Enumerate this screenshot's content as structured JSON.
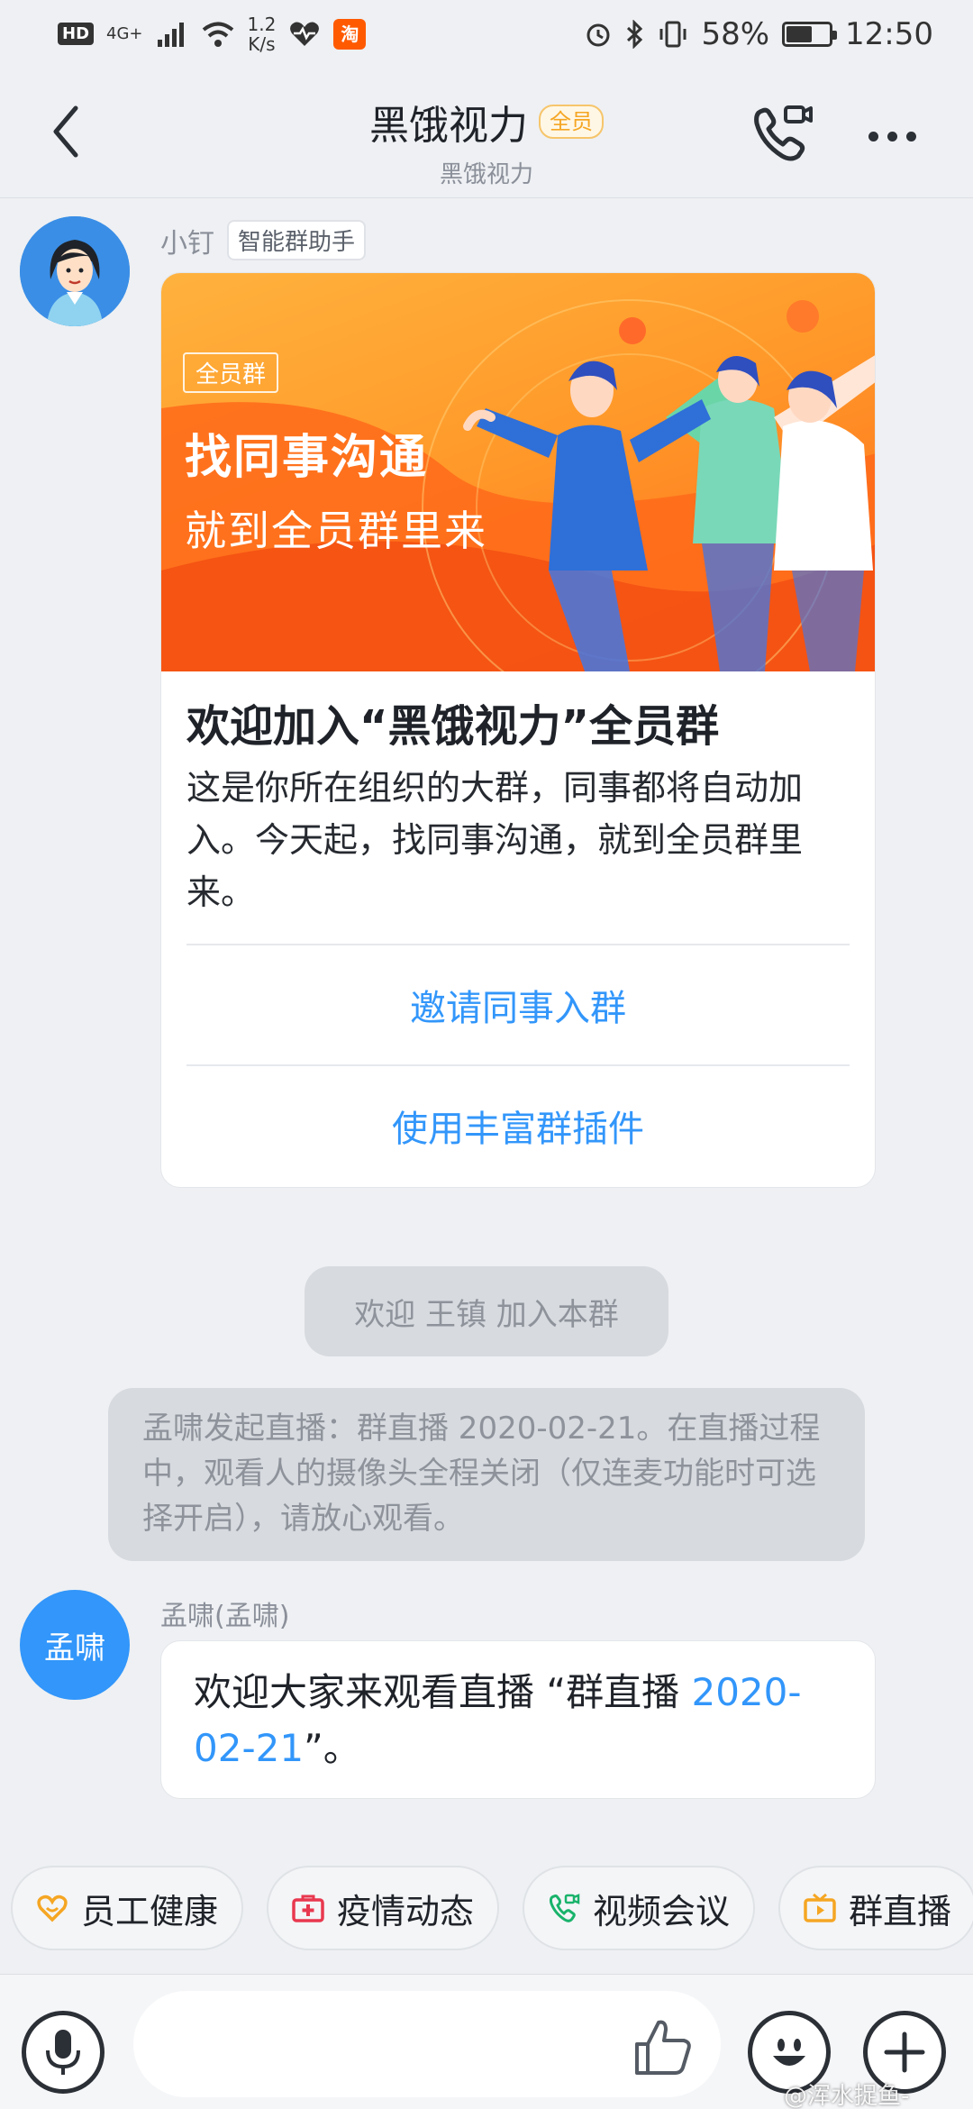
{
  "status_bar": {
    "hd": "HD",
    "network": "4G+",
    "speed_value": "1.2",
    "speed_unit": "K/s",
    "taobao_icon": "淘",
    "battery": "58%",
    "battery_level": 0.58,
    "time": "12:50",
    "icons": [
      "hd-badge",
      "signal-icon",
      "wifi-icon",
      "health-heart-icon",
      "taobao-icon",
      "alarm-icon",
      "bluetooth-icon",
      "vibrate-icon",
      "battery-icon"
    ]
  },
  "header": {
    "title": "黑饿视力",
    "badge": "全员",
    "subtitle": "黑饿视力",
    "icons": [
      "back-icon",
      "video-call-icon",
      "more-icon"
    ]
  },
  "messages": {
    "bot": {
      "sender": "小钉",
      "sender_tag": "智能群助手",
      "card": {
        "banner_tag": "全员群",
        "banner_title": "找同事沟通",
        "banner_subtitle": "就到全员群里来",
        "title": "欢迎加入“黑饿视力”全员群",
        "description": "这是你所在组织的大群，同事都将自动加入。今天起，找同事沟通，就到全员群里来。",
        "action_invite": "邀请同事入群",
        "action_plugins": "使用丰富群插件"
      }
    },
    "system_welcome": "欢迎 王镇 加入本群",
    "system_live_notice": "孟啸发起直播：群直播 2020-02-21。在直播过程中，观看人的摄像头全程关闭（仅连麦功能时可选择开启），请放心观看。",
    "user": {
      "avatar_text": "孟啸",
      "sender": "孟啸(孟啸)",
      "text_before": "欢迎大家来观看直播 “群直播 ",
      "link": "2020-02-21",
      "text_after": "”。"
    }
  },
  "quick_actions": [
    {
      "label": "员工健康",
      "icon": "heart-icon",
      "color": "#f5a623"
    },
    {
      "label": "疫情动态",
      "icon": "medical-kit-icon",
      "color": "#e8384f"
    },
    {
      "label": "视频会议",
      "icon": "video-call-icon",
      "color": "#19b36b"
    },
    {
      "label": "群直播",
      "icon": "tv-icon",
      "color": "#f5a623"
    }
  ],
  "input_bar": {
    "placeholder": "",
    "icons": [
      "microphone-icon",
      "thumbs-up-icon",
      "emoji-icon",
      "plus-icon"
    ]
  },
  "colors": {
    "accent_blue": "#3296fa",
    "badge_orange": "#f5a623",
    "background": "#eef0f3"
  },
  "watermark": "@浑水捉鱼-"
}
